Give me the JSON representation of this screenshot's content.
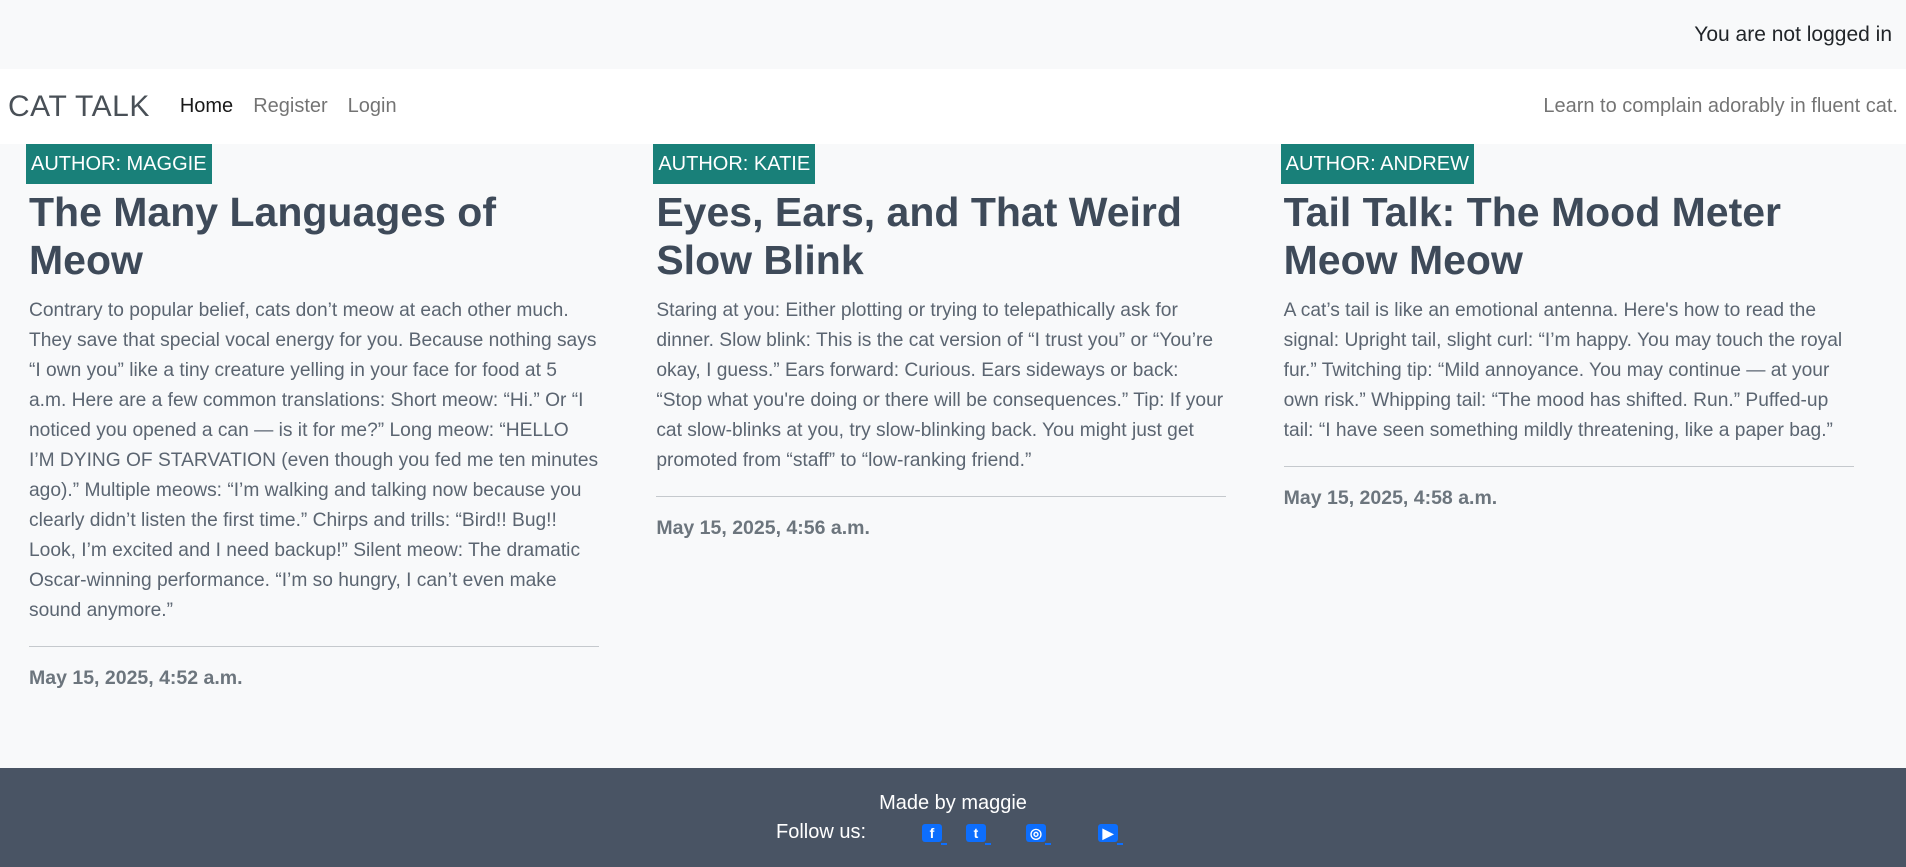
{
  "status": {
    "login_text": "You are not logged in"
  },
  "navbar": {
    "brand": "CAT TALK",
    "links": [
      "Home",
      "Register",
      "Login"
    ],
    "tagline": "Learn to complain adorably in fluent cat."
  },
  "posts": [
    {
      "author": "AUTHOR: MAGGIE",
      "title": "The Many Languages of Meow",
      "body": "Contrary to popular belief, cats don’t meow at each other much. They save that special vocal energy for you. Because nothing says “I own you” like a tiny creature yelling in your face for food at 5 a.m. Here are a few common translations: Short meow: “Hi.” Or “I noticed you opened a can — is it for me?” Long meow: “HELLO I’M DYING OF STARVATION (even though you fed me ten minutes ago).” Multiple meows: “I’m walking and talking now because you clearly didn’t listen the first time.” Chirps and trills: “Bird!! Bug!! Look, I’m excited and I need backup!” Silent meow: The dramatic Oscar-winning performance. “I’m so hungry, I can’t even make sound anymore.”",
      "date": "May 15, 2025, 4:52 a.m."
    },
    {
      "author": "AUTHOR: KATIE",
      "title": "Eyes, Ears, and That Weird Slow Blink",
      "body": "Staring at you: Either plotting or trying to telepathically ask for dinner. Slow blink: This is the cat version of “I trust you” or “You’re okay, I guess.” Ears forward: Curious. Ears sideways or back: “Stop what you're doing or there will be consequences.” Tip: If your cat slow-blinks at you, try slow-blinking back. You might just get promoted from “staff” to “low-ranking friend.”",
      "date": "May 15, 2025, 4:56 a.m."
    },
    {
      "author": "AUTHOR: ANDREW",
      "title": "Tail Talk: The Mood Meter Meow Meow",
      "body": "A cat’s tail is like an emotional antenna. Here's how to read the signal: Upright tail, slight curl: “I’m happy. You may touch the royal fur.” Twitching tip: “Mild annoyance. You may continue — at your own risk.” Whipping tail: “The mood has shifted. Run.” Puffed-up tail: “I have seen something mildly threatening, like a paper bag.”",
      "date": "May 15, 2025, 4:58 a.m."
    }
  ],
  "footer": {
    "made_by": "Made by maggie",
    "follow_label": "Follow us:",
    "social_icons": [
      "facebook-icon",
      "twitter-icon",
      "instagram-icon",
      "youtube-icon"
    ],
    "icon_color": "#0d6efd"
  },
  "colors": {
    "badge": "#198079",
    "footer_bg": "#495464",
    "title": "#3e4a59"
  }
}
